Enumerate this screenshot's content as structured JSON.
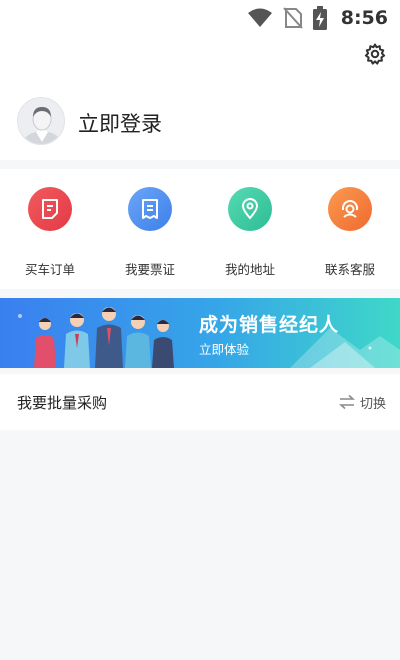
{
  "status_bar": {
    "time": "8:56",
    "icons": [
      "wifi-icon",
      "no-sim-icon",
      "battery-charging-icon"
    ]
  },
  "profile": {
    "settings_icon": "gear-icon",
    "login_text": "立即登录"
  },
  "quick_menu": {
    "items": [
      {
        "label": "买车订单",
        "icon": "order-icon",
        "color": "#e8434c"
      },
      {
        "label": "我要票证",
        "icon": "ticket-icon",
        "color": "#4e8df0"
      },
      {
        "label": "我的地址",
        "icon": "location-pin-icon",
        "color": "#3ec9a1"
      },
      {
        "label": "联系客服",
        "icon": "customer-service-icon",
        "color": "#f57a3a"
      }
    ]
  },
  "banner": {
    "title": "成为销售经纪人",
    "subtitle": "立即体验"
  },
  "bulk_purchase": {
    "title": "我要批量采购",
    "switch_label": "切换",
    "switch_icon": "swap-arrows-icon"
  }
}
